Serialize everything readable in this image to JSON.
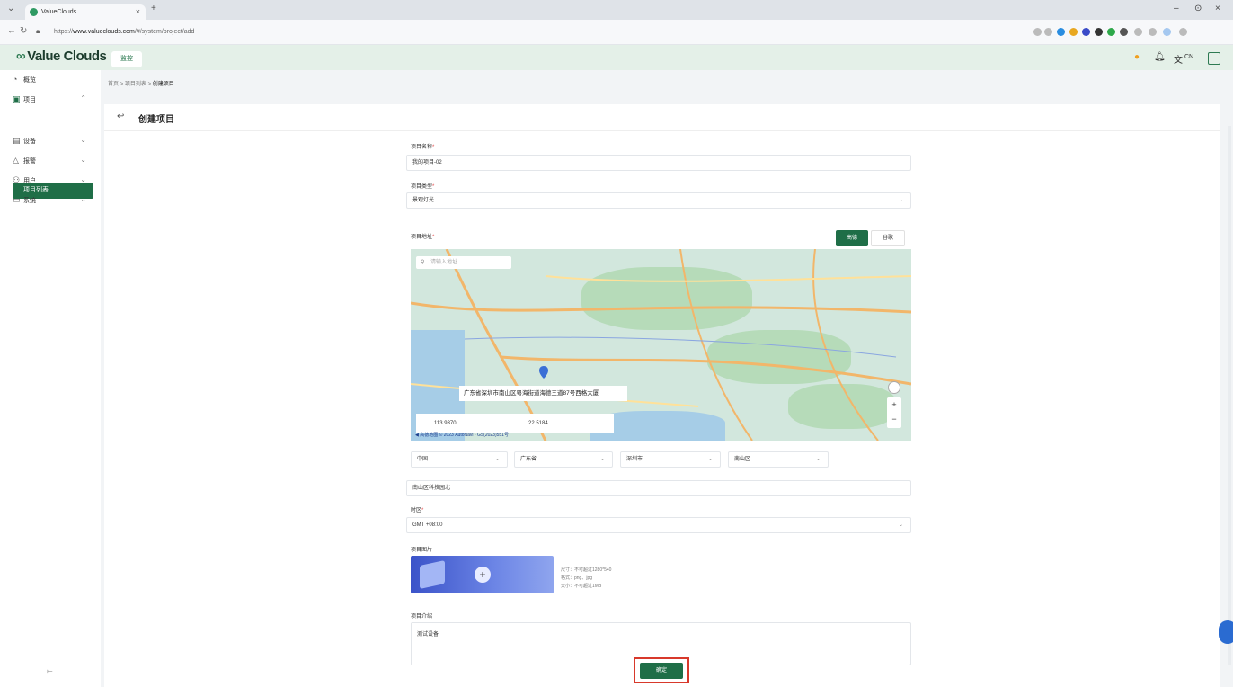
{
  "browser": {
    "tab_title": "ValueClouds",
    "tab_close": "×",
    "new_tab": "+",
    "url_prefix": "https://",
    "url_domain": "www.valueclouds.com",
    "url_path": "/#/system/project/add",
    "window_controls": [
      "–",
      "⊙",
      "×"
    ]
  },
  "app": {
    "logo_text": "Value Clouds",
    "top_tab": "监控",
    "lang": "CN",
    "brand_color": "#1f6e47"
  },
  "sidebar": {
    "items": [
      {
        "icon": "dashboard-icon",
        "label": "概览"
      },
      {
        "icon": "project-icon",
        "label": "项目"
      },
      {
        "icon": "device-icon",
        "label": "设备"
      },
      {
        "icon": "alarm-icon",
        "label": "报警"
      },
      {
        "icon": "user-icon",
        "label": "用户"
      },
      {
        "icon": "system-icon",
        "label": "系统"
      }
    ],
    "active_sub": "项目列表"
  },
  "breadcrumb": {
    "home": "首页",
    "parent": "项目列表",
    "current": "创建项目",
    "sep": ">"
  },
  "page": {
    "title": "创建项目",
    "back": "↩"
  },
  "form": {
    "name_label": "项目名称",
    "name_value": "我的项目-02",
    "type_label": "项目类型",
    "type_value": "景观灯光",
    "address_label": "项目地址",
    "mode_active": "高德",
    "mode_other": "谷歌",
    "map_search_placeholder": "请输入地址",
    "map_popup": "广东省深圳市南山区粤海街道海德三道87号西格大厦",
    "longitude": "113.9370",
    "latitude": "22.5184",
    "map_footer": "◀ 高德地图 © 2023 AutoNavi - GS(2023)551号",
    "country": "中国",
    "province": "广东省",
    "city": "深圳市",
    "district": "南山区",
    "street_value": "南山区科技园北",
    "timezone_label": "时区",
    "timezone_value": "GMT +08:00",
    "image_label": "项目图片",
    "image_hint_1": "尺寸：不可超过1280*540",
    "image_hint_2": "格式：png、jpg",
    "image_hint_3": "大小：不可超过1MB",
    "desc_label": "项目介绍",
    "desc_value": "测试设备",
    "confirm": "确定",
    "required_mark": "*"
  }
}
